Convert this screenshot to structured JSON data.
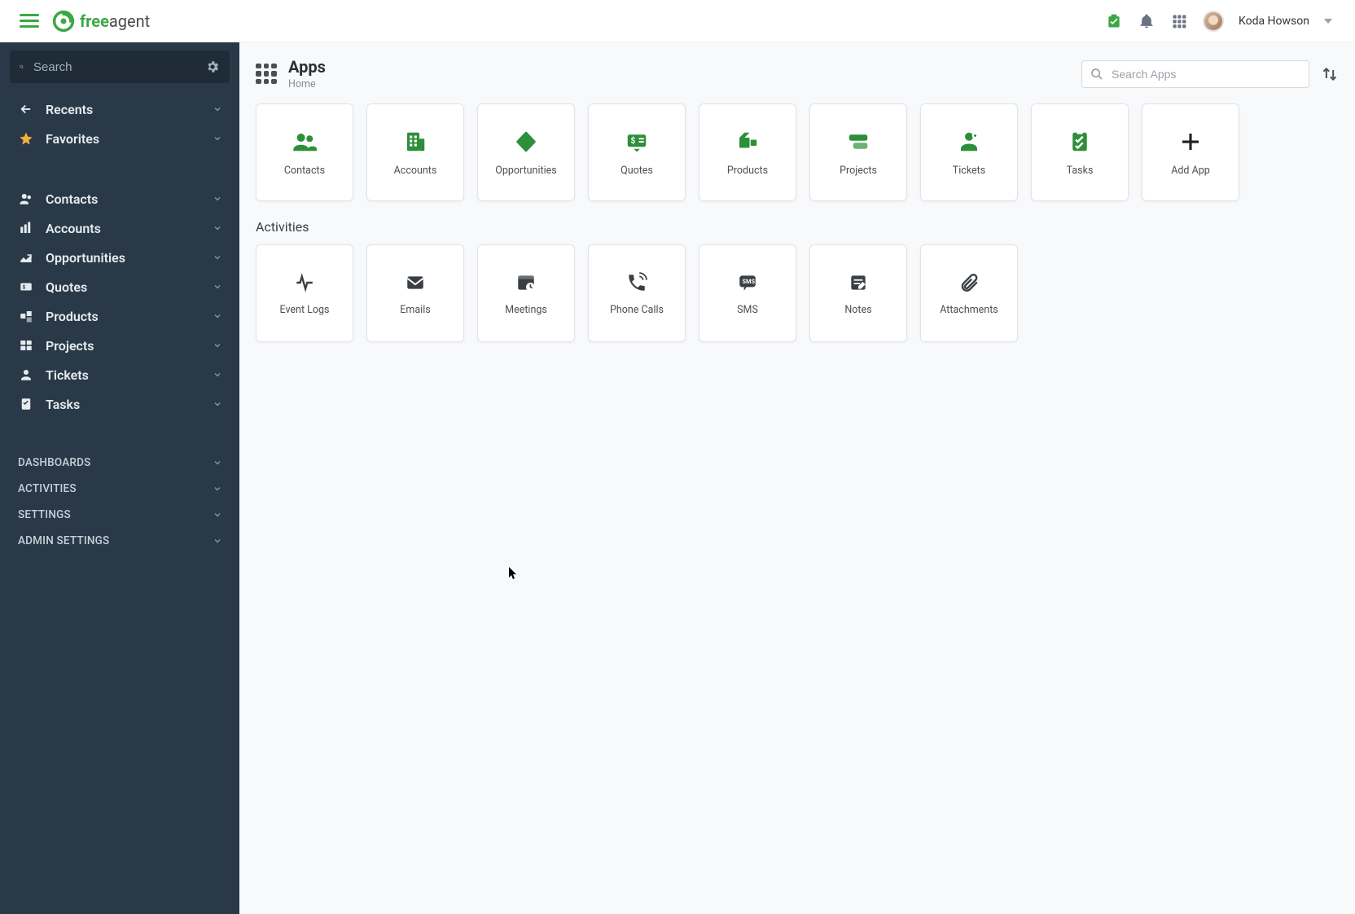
{
  "brand": {
    "free": "free",
    "agent": "agent"
  },
  "user": {
    "name": "Koda Howson"
  },
  "search": {
    "sidebarPlaceholder": "Search",
    "appsPlaceholder": "Search Apps"
  },
  "nav": {
    "recents": "Recents",
    "favorites": "Favorites",
    "items": [
      {
        "label": "Contacts"
      },
      {
        "label": "Accounts"
      },
      {
        "label": "Opportunities"
      },
      {
        "label": "Quotes"
      },
      {
        "label": "Products"
      },
      {
        "label": "Projects"
      },
      {
        "label": "Tickets"
      },
      {
        "label": "Tasks"
      }
    ],
    "meta": [
      {
        "label": "DASHBOARDS"
      },
      {
        "label": "ACTIVITIES"
      },
      {
        "label": "SETTINGS"
      },
      {
        "label": "ADMIN SETTINGS"
      }
    ]
  },
  "page": {
    "title": "Apps",
    "breadcrumb": "Home",
    "apps": [
      {
        "label": "Contacts",
        "icon": "contacts"
      },
      {
        "label": "Accounts",
        "icon": "accounts"
      },
      {
        "label": "Opportunities",
        "icon": "opportunities"
      },
      {
        "label": "Quotes",
        "icon": "quotes"
      },
      {
        "label": "Products",
        "icon": "products"
      },
      {
        "label": "Projects",
        "icon": "projects"
      },
      {
        "label": "Tickets",
        "icon": "tickets"
      },
      {
        "label": "Tasks",
        "icon": "tasks"
      },
      {
        "label": "Add App",
        "icon": "add"
      }
    ],
    "activitiesLabel": "Activities",
    "activities": [
      {
        "label": "Event Logs",
        "icon": "pulse"
      },
      {
        "label": "Emails",
        "icon": "envelope"
      },
      {
        "label": "Meetings",
        "icon": "calendar-clock"
      },
      {
        "label": "Phone Calls",
        "icon": "phone"
      },
      {
        "label": "SMS",
        "icon": "sms"
      },
      {
        "label": "Notes",
        "icon": "note"
      },
      {
        "label": "Attachments",
        "icon": "paperclip"
      }
    ]
  }
}
